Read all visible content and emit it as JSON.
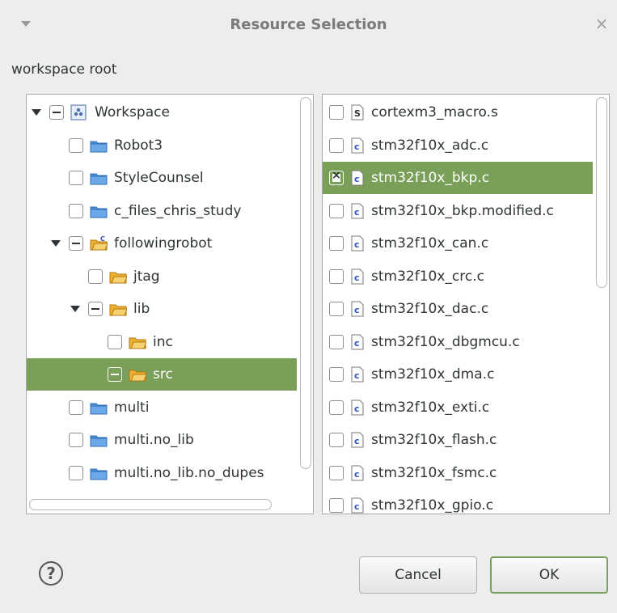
{
  "window": {
    "title": "Resource Selection",
    "close_glyph": "×"
  },
  "root_label": "workspace root",
  "tree": [
    {
      "label": "Workspace",
      "depth": 0,
      "expander": "expanded",
      "check": "tri",
      "icon": "workspace-icon",
      "selected": false
    },
    {
      "label": "Robot3",
      "depth": 1,
      "expander": "none",
      "check": "unchecked",
      "icon": "project-icon",
      "selected": false
    },
    {
      "label": "StyleCounsel",
      "depth": 1,
      "expander": "none",
      "check": "unchecked",
      "icon": "project-icon",
      "selected": false
    },
    {
      "label": "c_files_chris_study",
      "depth": 1,
      "expander": "none",
      "check": "unchecked",
      "icon": "project-icon",
      "selected": false
    },
    {
      "label": "followingrobot",
      "depth": 1,
      "expander": "expanded",
      "check": "tri",
      "icon": "c-project-icon",
      "selected": false
    },
    {
      "label": "jtag",
      "depth": 2,
      "expander": "none",
      "check": "unchecked",
      "icon": "folder-icon",
      "selected": false
    },
    {
      "label": "lib",
      "depth": 2,
      "expander": "expanded",
      "check": "tri",
      "icon": "folder-icon",
      "selected": false
    },
    {
      "label": "inc",
      "depth": 3,
      "expander": "none",
      "check": "unchecked",
      "icon": "folder-icon",
      "selected": false
    },
    {
      "label": "src",
      "depth": 3,
      "expander": "none",
      "check": "tri",
      "icon": "folder-icon",
      "selected": true
    },
    {
      "label": "multi",
      "depth": 1,
      "expander": "none",
      "check": "unchecked",
      "icon": "project-icon",
      "selected": false
    },
    {
      "label": "multi.no_lib",
      "depth": 1,
      "expander": "none",
      "check": "unchecked",
      "icon": "project-icon",
      "selected": false
    },
    {
      "label": "multi.no_lib.no_dupes",
      "depth": 1,
      "expander": "none",
      "check": "unchecked",
      "icon": "project-icon",
      "selected": false
    }
  ],
  "files": [
    {
      "label": "cortexm3_macro.s",
      "icon": "asm-file-icon",
      "checked": false,
      "selected": false
    },
    {
      "label": "stm32f10x_adc.c",
      "icon": "c-file-icon",
      "checked": false,
      "selected": false
    },
    {
      "label": "stm32f10x_bkp.c",
      "icon": "c-file-icon",
      "checked": true,
      "selected": true
    },
    {
      "label": "stm32f10x_bkp.modified.c",
      "icon": "c-file-icon",
      "checked": false,
      "selected": false
    },
    {
      "label": "stm32f10x_can.c",
      "icon": "c-file-icon",
      "checked": false,
      "selected": false
    },
    {
      "label": "stm32f10x_crc.c",
      "icon": "c-file-icon",
      "checked": false,
      "selected": false
    },
    {
      "label": "stm32f10x_dac.c",
      "icon": "c-file-icon",
      "checked": false,
      "selected": false
    },
    {
      "label": "stm32f10x_dbgmcu.c",
      "icon": "c-file-icon",
      "checked": false,
      "selected": false
    },
    {
      "label": "stm32f10x_dma.c",
      "icon": "c-file-icon",
      "checked": false,
      "selected": false
    },
    {
      "label": "stm32f10x_exti.c",
      "icon": "c-file-icon",
      "checked": false,
      "selected": false
    },
    {
      "label": "stm32f10x_flash.c",
      "icon": "c-file-icon",
      "checked": false,
      "selected": false
    },
    {
      "label": "stm32f10x_fsmc.c",
      "icon": "c-file-icon",
      "checked": false,
      "selected": false
    },
    {
      "label": "stm32f10x_gpio.c",
      "icon": "c-file-icon",
      "checked": false,
      "selected": false
    }
  ],
  "buttons": {
    "help": "?",
    "cancel": "Cancel",
    "ok": "OK"
  },
  "colors": {
    "selection": "#799f58",
    "folder_blue": "#4a90d9",
    "folder_yellow": "#f0b030"
  }
}
